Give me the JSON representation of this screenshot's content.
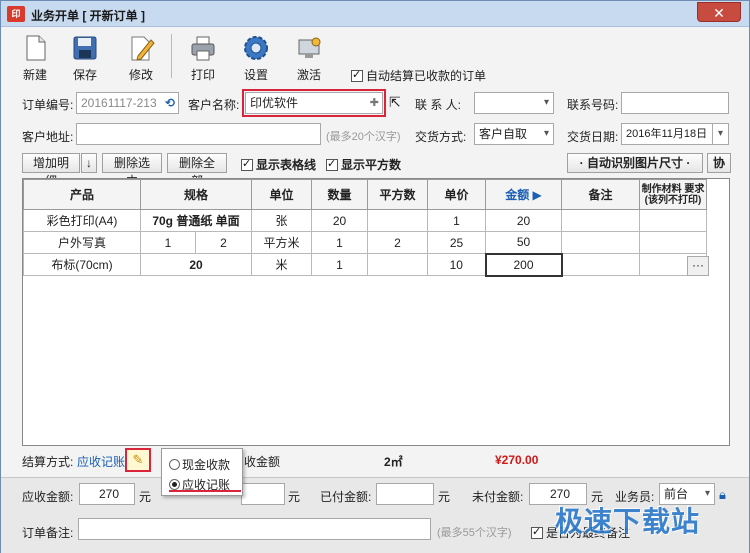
{
  "window": {
    "title": "业务开单 [ 开新订单 ]",
    "icon_text": "印",
    "close_label": "✕"
  },
  "toolbar": {
    "new": "新建",
    "save": "保存",
    "edit": "修改",
    "print": "打印",
    "settings": "设置",
    "activate": "激活",
    "auto_settle_label": "自动结算已收款的订单",
    "auto_settle_checked": true
  },
  "form": {
    "order_no_label": "订单编号:",
    "order_no_value": "20161117-213",
    "customer_label": "客户名称:",
    "customer_value": "印优软件",
    "contact_label": "联 系 人:",
    "contact_value": "",
    "phone_label": "联系号码:",
    "phone_value": "",
    "address_label": "客户地址:",
    "address_value": "",
    "address_hint": "(最多20个汉字)",
    "delivery_label": "交货方式:",
    "delivery_value": "客户自取",
    "date_label": "交货日期:",
    "date_value": "2016年11月18日"
  },
  "actions": {
    "add_detail": "增加明细",
    "down_arrow": "↓",
    "delete_selected": "删除选中",
    "delete_all": "删除全部",
    "show_gridlines": "显示表格线",
    "show_sqm": "显示平方数",
    "auto_recognize": "· 自动识别图片尺寸 ·",
    "help": "协"
  },
  "table": {
    "headers": [
      "产品",
      "规格",
      "单位",
      "数量",
      "平方数",
      "单价",
      "金额 ▶",
      "备注",
      "制作材料 要求 (该列不打印)"
    ],
    "rows": [
      {
        "product": "彩色打印(A4)",
        "spec": "70g 普通纸 单面",
        "unit": "张",
        "qty": "20",
        "sqm": "",
        "price": "1",
        "amount": "20",
        "note": ""
      },
      {
        "product": "户外写真",
        "spec_w": "1",
        "spec_h": "2",
        "unit": "平方米",
        "qty": "1",
        "sqm": "2",
        "price": "25",
        "amount": "50",
        "note": ""
      },
      {
        "product": "布标(70cm)",
        "spec": "20",
        "unit": "米",
        "qty": "1",
        "sqm": "",
        "price": "10",
        "amount": "200",
        "note": ""
      }
    ],
    "ellipsis": "···"
  },
  "summary": {
    "settle_label": "结算方式:",
    "settle_value": "应收记账",
    "pencil": "✎",
    "cash_option": "现金收款",
    "ar_option": "应收记账",
    "receivable_label": "收金额",
    "sqm_total": "2㎡",
    "total_amount": "¥270.00"
  },
  "bottom": {
    "ar_amount_label": "应收金额:",
    "ar_amount_value": "270",
    "yuan": "元",
    "discount_value": "",
    "paid_label": "已付金额:",
    "paid_value": "",
    "unpaid_label": "未付金额:",
    "unpaid_value": "270",
    "staff_label": "业务员:",
    "staff_value": "前台",
    "remark_label": "订单备注:",
    "remark_value": "",
    "remark_hint": "(最多55个汉字)",
    "final_chk_label": "是否为最终备注",
    "watermark": "极速下载站"
  },
  "colors": {
    "accent_red": "#d9243b",
    "amount_red": "#d01818",
    "header_blue": "#1b5fb3"
  }
}
